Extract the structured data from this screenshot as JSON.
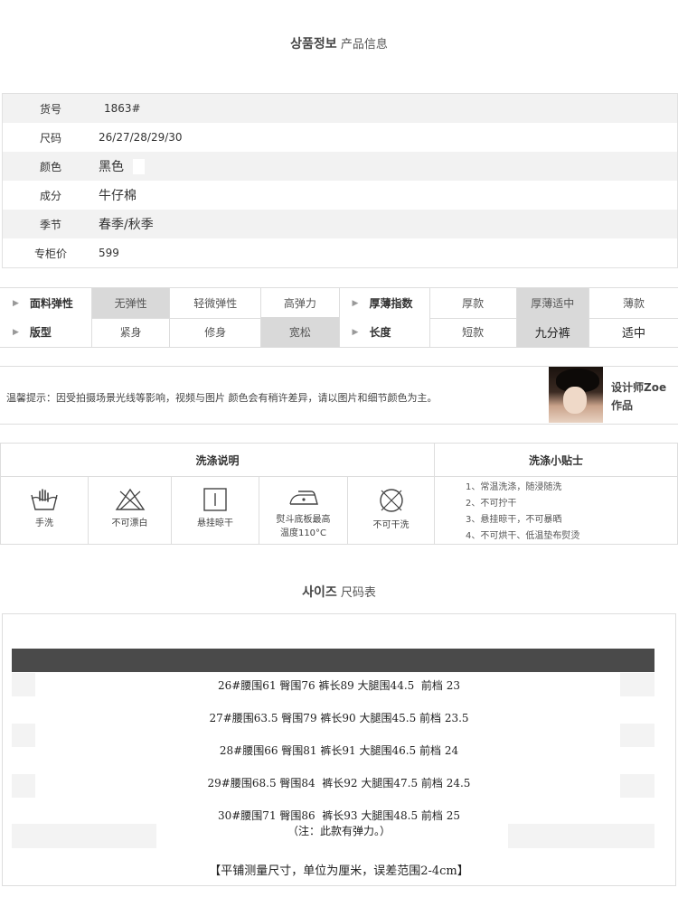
{
  "product_info_title": {
    "ko": "상품정보",
    "zh": "产品信息"
  },
  "info_rows": [
    {
      "label": "货号",
      "value": "1863#"
    },
    {
      "label": "尺码",
      "value": "26/27/28/29/30"
    },
    {
      "label": "颜色",
      "value": "黑色"
    },
    {
      "label": "成分",
      "value": "牛仔棉"
    },
    {
      "label": "季节",
      "value": "春季/秋季"
    },
    {
      "label": "专柜价",
      "value": "599"
    }
  ],
  "attributes": {
    "row1": {
      "h1": "面料弹性",
      "opts1": [
        "无弹性",
        "轻微弹性",
        "高弹力"
      ],
      "sel1": 0,
      "h2": "厚薄指数",
      "opts2": [
        "厚款",
        "厚薄适中",
        "薄款"
      ],
      "sel2": 1
    },
    "row2": {
      "h1": "版型",
      "opts1": [
        "紧身",
        "修身",
        "宽松"
      ],
      "sel1": 2,
      "h2": "长度",
      "opts2": [
        "短款",
        "九分裤",
        "适中"
      ],
      "sel2": 1
    }
  },
  "notice": {
    "text": "温馨提示：因受拍摄场景光线等影响，视频与图片 颜色会有稍许差异，请以图片和细节颜色为主。",
    "designer_line1": "设计师Zoe",
    "designer_line2": "作品"
  },
  "washing": {
    "title_left": "洗涤说明",
    "title_right": "洗涤小贴士",
    "icons": [
      {
        "icon": "hand-wash-icon",
        "label": "手洗"
      },
      {
        "icon": "no-bleach-icon",
        "label": "不可漂白"
      },
      {
        "icon": "hang-dry-icon",
        "label": "悬挂晾干"
      },
      {
        "icon": "iron-icon",
        "label": "熨斗底板最高",
        "label2": "温度110°C"
      },
      {
        "icon": "no-dry-clean-icon",
        "label": "不可干洗"
      }
    ],
    "tips": [
      "1、常温洗涤，随浸随洗",
      "2、不可拧干",
      "3、悬挂晾干，不可暴晒",
      "4、不可烘干、低温垫布熨烫"
    ]
  },
  "size_title": {
    "ko": "사이즈",
    "zh": "尺码表"
  },
  "size_rows": [
    "26#腰围61 臀围76 裤长89 大腿围44.5  前档 23",
    "27#腰围63.5 臀围79 裤长90 大腿围45.5 前档 23.5",
    "28#腰围66 臀围81 裤长91 大腿围46.5 前档 24",
    "29#腰围68.5 臀围84  裤长92 大腿围47.5 前档 24.5",
    "30#腰围71 臀围86  裤长93 大腿围48.5 前档 25"
  ],
  "size_note": "（注：此款有弹力。）",
  "size_footer": "【平铺测量尺寸，单位为厘米，误差范围2-4cm】"
}
